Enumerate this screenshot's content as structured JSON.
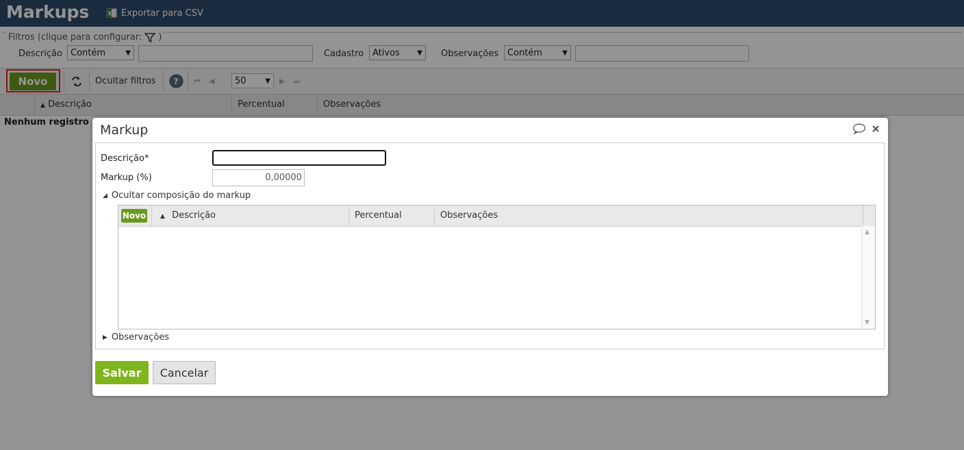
{
  "header": {
    "title": "Markups",
    "export_label": "Exportar para CSV",
    "export_icon": "excel-icon"
  },
  "filters": {
    "legend": "Filtros (clique para configurar:",
    "legend_close": ")",
    "descricao_label": "Descrição",
    "descricao_op": "Contém",
    "descricao_value": "",
    "cadastro_label": "Cadastro",
    "cadastro_value": "Ativos",
    "observacoes_label": "Observações",
    "observacoes_op": "Contém",
    "observacoes_value": ""
  },
  "toolbar": {
    "novo_label": "Novo",
    "hide_filters_label": "Ocultar filtros",
    "page_size": "50"
  },
  "grid": {
    "columns": [
      "Descrição",
      "Percentual",
      "Observações"
    ],
    "empty_text": "Nenhum registro"
  },
  "dialog": {
    "title": "Markup",
    "descricao_label": "Descrição*",
    "descricao_value": "",
    "markup_label": "Markup (%)",
    "markup_value": "0,00000",
    "composition_toggle": "Ocultar composição do markup",
    "subgrid": {
      "novo_label": "Novo",
      "columns": [
        "Descrição",
        "Percentual",
        "Observações"
      ]
    },
    "observacoes_toggle": "Observações",
    "save_label": "Salvar",
    "cancel_label": "Cancelar"
  },
  "colors": {
    "header_bg": "#2f4a6b",
    "accent_green": "#7fb51c",
    "highlight_red": "#ee2222"
  }
}
